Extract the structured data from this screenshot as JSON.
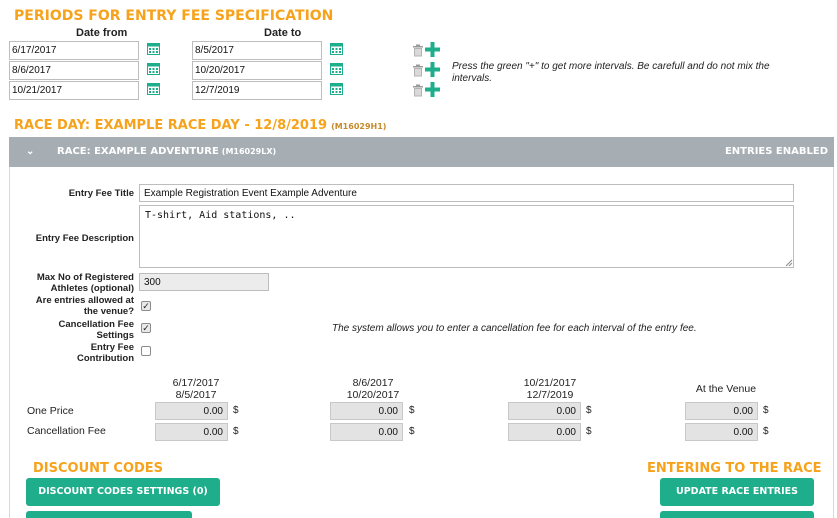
{
  "periods": {
    "heading": "PERIODS FOR ENTRY FEE SPECIFICATION",
    "col_from": "Date from",
    "col_to": "Date to",
    "rows": [
      {
        "from": "6/17/2017",
        "to": "8/5/2017"
      },
      {
        "from": "8/6/2017",
        "to": "10/20/2017"
      },
      {
        "from": "10/21/2017",
        "to": "12/7/2019"
      }
    ],
    "note": "Press the green \"+\" to get more intervals. Be carefull and do not mix the intervals."
  },
  "race_day": {
    "heading": "RACE DAY: EXAMPLE RACE DAY - 12/8/2019",
    "code": "(M16029H1)"
  },
  "race": {
    "title": "RACE: EXAMPLE ADVENTURE",
    "code": "(M16029LX)",
    "status": "ENTRIES ENABLED",
    "entry_fee_title_label": "Entry Fee Title",
    "entry_fee_title_value": "Example Registration Event Example Adventure",
    "entry_fee_desc_label": "Entry Fee Description",
    "entry_fee_desc_value": "T-shirt, Aid stations, ..",
    "max_label_1": "Max No of Registered",
    "max_label_2": "Athletes (optional)",
    "max_value": "300",
    "venue_label_1": "Are entries allowed at",
    "venue_label_2": "the venue?",
    "cancel_label_1": "Cancellation Fee",
    "cancel_label_2": "Settings",
    "contrib_label_1": "Entry Fee",
    "contrib_label_2": "Contribution",
    "cancel_note": "The system allows you to enter a cancellation fee for each interval of the entry fee."
  },
  "pricing": {
    "columns": [
      {
        "line1": "6/17/2017",
        "line2": "8/5/2017"
      },
      {
        "line1": "8/6/2017",
        "line2": "10/20/2017"
      },
      {
        "line1": "10/21/2017",
        "line2": "12/7/2019"
      },
      {
        "line1": "At the Venue",
        "line2": ""
      }
    ],
    "row_one_price": "One Price",
    "row_cancel_fee": "Cancellation Fee",
    "one_price_values": [
      "0.00",
      "0.00",
      "0.00",
      "0.00"
    ],
    "cancel_values": [
      "0.00",
      "0.00",
      "0.00",
      "0.00"
    ],
    "currency": "$"
  },
  "discount": {
    "heading": "DISCOUNT CODES",
    "settings_button": "DISCOUNT CODES SETTINGS (0)"
  },
  "entering": {
    "heading": "ENTERING TO THE RACE",
    "update_button": "UPDATE RACE ENTRIES"
  },
  "colors": {
    "accent_orange": "#f7a21b",
    "green": "#1fae8b",
    "bar_grey": "#a6aeb4"
  }
}
